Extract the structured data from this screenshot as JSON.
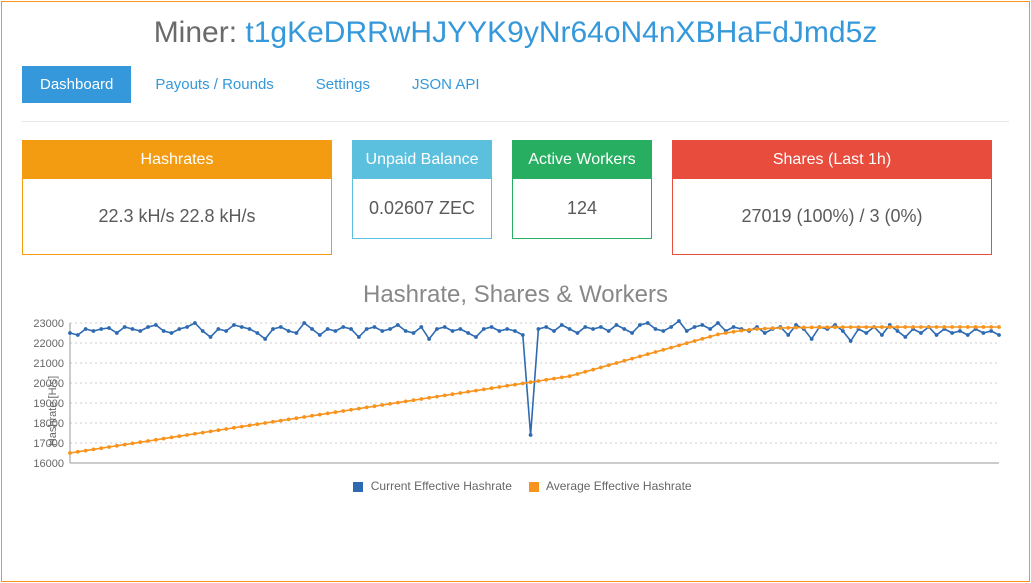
{
  "title_prefix": "Miner: ",
  "miner_address": "t1gKeDRRwHJYYK9yNr64oN4nXBHaFdJmd5z",
  "tabs": {
    "dashboard": "Dashboard",
    "payouts": "Payouts / Rounds",
    "settings": "Settings",
    "jsonapi": "JSON API"
  },
  "cards": {
    "hashrates": {
      "label": "Hashrates",
      "value": "22.3 kH/s   22.8 kH/s"
    },
    "unpaid": {
      "label": "Unpaid Balance",
      "value": "0.02607 ZEC"
    },
    "workers": {
      "label": "Active Workers",
      "value": "124"
    },
    "shares": {
      "label": "Shares (Last 1h)",
      "value": "27019 (100%) / 3 (0%)"
    }
  },
  "chart_title": "Hashrate, Shares & Workers",
  "legend": {
    "current": "Current Effective Hashrate",
    "average": "Average Effective Hashrate"
  },
  "ylabel": "Hashrate [H/s]",
  "chart_data": {
    "type": "line",
    "ylabel": "Hashrate [H/s]",
    "ylim": [
      16000,
      23000
    ],
    "yticks": [
      16000,
      17000,
      18000,
      19000,
      20000,
      21000,
      22000,
      23000
    ],
    "series": [
      {
        "name": "Current Effective Hashrate",
        "color": "#2e6ab1",
        "values": [
          22500,
          22400,
          22700,
          22600,
          22700,
          22750,
          22500,
          22800,
          22700,
          22600,
          22800,
          22900,
          22600,
          22500,
          22700,
          22800,
          23000,
          22600,
          22300,
          22700,
          22600,
          22900,
          22800,
          22700,
          22500,
          22200,
          22700,
          22800,
          22600,
          22500,
          23000,
          22700,
          22400,
          22700,
          22600,
          22800,
          22700,
          22300,
          22700,
          22800,
          22600,
          22700,
          22900,
          22600,
          22500,
          22800,
          22200,
          22700,
          22800,
          22600,
          22700,
          22500,
          22300,
          22700,
          22800,
          22600,
          22700,
          22600,
          22400,
          17400,
          22700,
          22800,
          22600,
          22900,
          22700,
          22500,
          22800,
          22700,
          22800,
          22600,
          22900,
          22700,
          22500,
          22900,
          23000,
          22700,
          22600,
          22800,
          23100,
          22600,
          22800,
          22900,
          22700,
          23000,
          22600,
          22800,
          22700,
          22600,
          22800,
          22500,
          22700,
          22800,
          22400,
          22900,
          22700,
          22200,
          22800,
          22700,
          22900,
          22600,
          22100,
          22700,
          22500,
          22800,
          22400,
          22900,
          22600,
          22300,
          22700,
          22500,
          22800,
          22400,
          22700,
          22500,
          22600,
          22400,
          22700,
          22500,
          22600,
          22400
        ],
        "marker": true
      },
      {
        "name": "Average Effective Hashrate",
        "color": "#f7941e",
        "values": [
          16500,
          16560,
          16620,
          16680,
          16740,
          16800,
          16860,
          16920,
          16980,
          17040,
          17100,
          17160,
          17220,
          17280,
          17340,
          17400,
          17460,
          17520,
          17580,
          17640,
          17700,
          17760,
          17820,
          17880,
          17940,
          18000,
          18060,
          18120,
          18180,
          18240,
          18300,
          18360,
          18420,
          18480,
          18540,
          18600,
          18660,
          18720,
          18780,
          18840,
          18900,
          18960,
          19020,
          19080,
          19140,
          19200,
          19260,
          19320,
          19380,
          19440,
          19500,
          19560,
          19620,
          19680,
          19740,
          19800,
          19860,
          19920,
          19980,
          20040,
          20100,
          20160,
          20220,
          20280,
          20340,
          20450,
          20560,
          20670,
          20780,
          20890,
          21000,
          21110,
          21220,
          21330,
          21440,
          21550,
          21660,
          21770,
          21880,
          21990,
          22100,
          22210,
          22320,
          22430,
          22500,
          22560,
          22620,
          22660,
          22700,
          22720,
          22740,
          22750,
          22760,
          22770,
          22775,
          22780,
          22785,
          22788,
          22790,
          22792,
          22793,
          22794,
          22795,
          22795,
          22796,
          22796,
          22797,
          22797,
          22798,
          22798,
          22798,
          22799,
          22799,
          22799,
          22800,
          22800,
          22800,
          22800,
          22800,
          22800
        ],
        "marker": true
      }
    ]
  }
}
